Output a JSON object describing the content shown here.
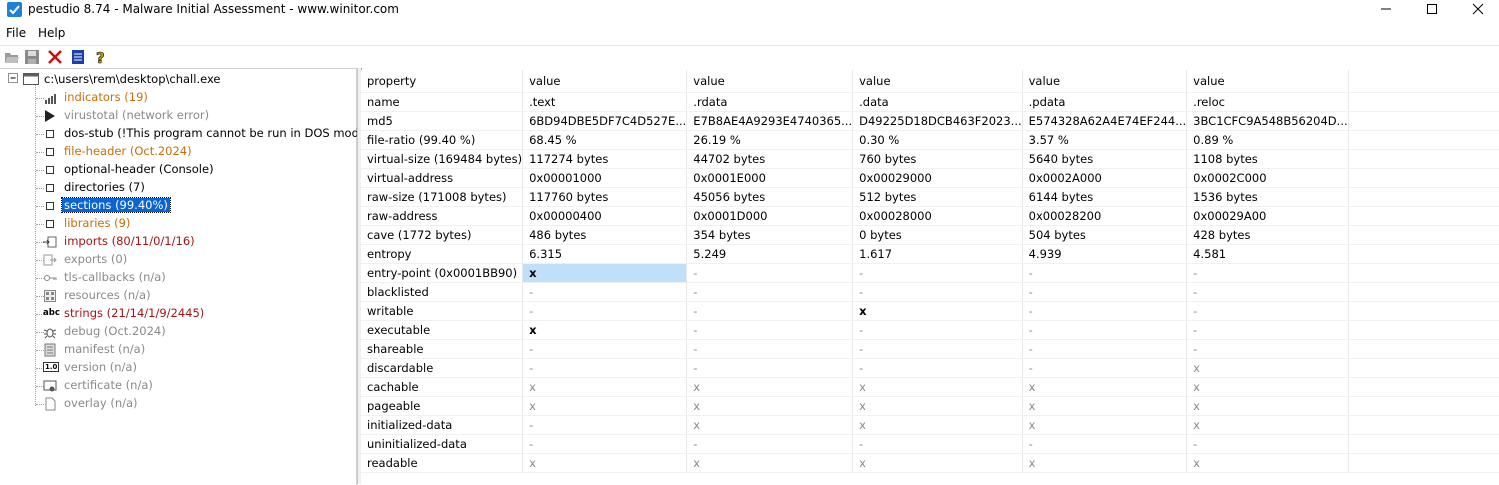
{
  "window": {
    "title": "pestudio 8.74 - Malware Initial Assessment - www.winitor.com"
  },
  "menu": [
    "File",
    "Help"
  ],
  "toolbar": {
    "icons": [
      "open-folder-icon",
      "save-icon",
      "delete-icon",
      "list-icon",
      "help-icon"
    ]
  },
  "tree": {
    "root": "c:\\users\\rem\\desktop\\chall.exe",
    "items": [
      {
        "label": "indicators (19)",
        "color": "orange",
        "icon": "indicators-icon"
      },
      {
        "label": "virustotal (network error)",
        "color": "gray",
        "icon": "virustotal-icon"
      },
      {
        "label": "dos-stub (!This program cannot be run in DOS mode.)",
        "color": "black",
        "icon": "box-icon"
      },
      {
        "label": "file-header (Oct.2024)",
        "color": "orange",
        "icon": "box-icon"
      },
      {
        "label": "optional-header (Console)",
        "color": "black",
        "icon": "box-icon"
      },
      {
        "label": "directories (7)",
        "color": "black",
        "icon": "box-icon"
      },
      {
        "label": "sections (99.40%)",
        "color": "selected",
        "icon": "box-icon"
      },
      {
        "label": "libraries (9)",
        "color": "orange",
        "icon": "box-icon"
      },
      {
        "label": "imports (80/11/0/1/16)",
        "color": "darkred",
        "icon": "imports-icon"
      },
      {
        "label": "exports (0)",
        "color": "gray",
        "icon": "exports-icon"
      },
      {
        "label": "tls-callbacks (n/a)",
        "color": "gray",
        "icon": "key-icon"
      },
      {
        "label": "resources (n/a)",
        "color": "gray",
        "icon": "resources-icon"
      },
      {
        "label": "strings (21/14/1/9/2445)",
        "color": "darkred",
        "icon": "abc-icon"
      },
      {
        "label": "debug (Oct.2024)",
        "color": "gray",
        "icon": "bug-icon"
      },
      {
        "label": "manifest (n/a)",
        "color": "gray",
        "icon": "manifest-icon"
      },
      {
        "label": "version (n/a)",
        "color": "gray",
        "icon": "version-icon"
      },
      {
        "label": "certificate (n/a)",
        "color": "gray",
        "icon": "certificate-icon"
      },
      {
        "label": "overlay (n/a)",
        "color": "gray",
        "icon": "overlay-icon"
      }
    ],
    "abc_glyph": "abc",
    "version_glyph": "1.0"
  },
  "grid": {
    "headers": [
      "property",
      "value",
      "value",
      "value",
      "value",
      "value"
    ],
    "rows": [
      [
        "name",
        ".text",
        ".rdata",
        ".data",
        ".pdata",
        ".reloc"
      ],
      [
        "md5",
        "6BD94DBE5DF7C4D527E...",
        "E7B8AE4A9293E4740365...",
        "D49225D18DCB463F2023...",
        "E574328A62A4E74EF244...",
        "3BC1CFC9A548B56204D..."
      ],
      [
        "file-ratio (99.40 %)",
        "68.45 %",
        "26.19 %",
        "0.30 %",
        "3.57 %",
        "0.89 %"
      ],
      [
        "virtual-size (169484 bytes)",
        "117274 bytes",
        "44702 bytes",
        "760 bytes",
        "5640 bytes",
        "1108 bytes"
      ],
      [
        "virtual-address",
        "0x00001000",
        "0x0001E000",
        "0x00029000",
        "0x0002A000",
        "0x0002C000"
      ],
      [
        "raw-size (171008 bytes)",
        "117760 bytes",
        "45056 bytes",
        "512 bytes",
        "6144 bytes",
        "1536 bytes"
      ],
      [
        "raw-address",
        "0x00000400",
        "0x0001D000",
        "0x00028000",
        "0x00028200",
        "0x00029A00"
      ],
      [
        "cave (1772 bytes)",
        "486 bytes",
        "354 bytes",
        "0 bytes",
        "504 bytes",
        "428 bytes"
      ],
      [
        "entropy",
        "6.315",
        "5.249",
        "1.617",
        "4.939",
        "4.581"
      ],
      [
        "entry-point (0x0001BB90)",
        "x",
        "-",
        "-",
        "-",
        "-"
      ],
      [
        "blacklisted",
        "-",
        "-",
        "-",
        "-",
        "-"
      ],
      [
        "writable",
        "-",
        "-",
        "x",
        "-",
        "-"
      ],
      [
        "executable",
        "x",
        "-",
        "-",
        "-",
        "-"
      ],
      [
        "shareable",
        "-",
        "-",
        "-",
        "-",
        "-"
      ],
      [
        "discardable",
        "-",
        "-",
        "-",
        "-",
        "x"
      ],
      [
        "cachable",
        "x",
        "x",
        "x",
        "x",
        "x"
      ],
      [
        "pageable",
        "x",
        "x",
        "x",
        "x",
        "x"
      ],
      [
        "initialized-data",
        "-",
        "x",
        "x",
        "x",
        "x"
      ],
      [
        "uninitialized-data",
        "-",
        "-",
        "-",
        "-",
        "-"
      ],
      [
        "readable",
        "x",
        "x",
        "x",
        "x",
        "x"
      ]
    ]
  },
  "colors": {
    "tree_orange": "#c86e0c",
    "tree_darkred": "#a31515",
    "tree_gray": "#8a8a8a",
    "selection": "#0a64d2",
    "cell_highlight": "#bee0f8",
    "app_icon": "#1e80d8"
  }
}
